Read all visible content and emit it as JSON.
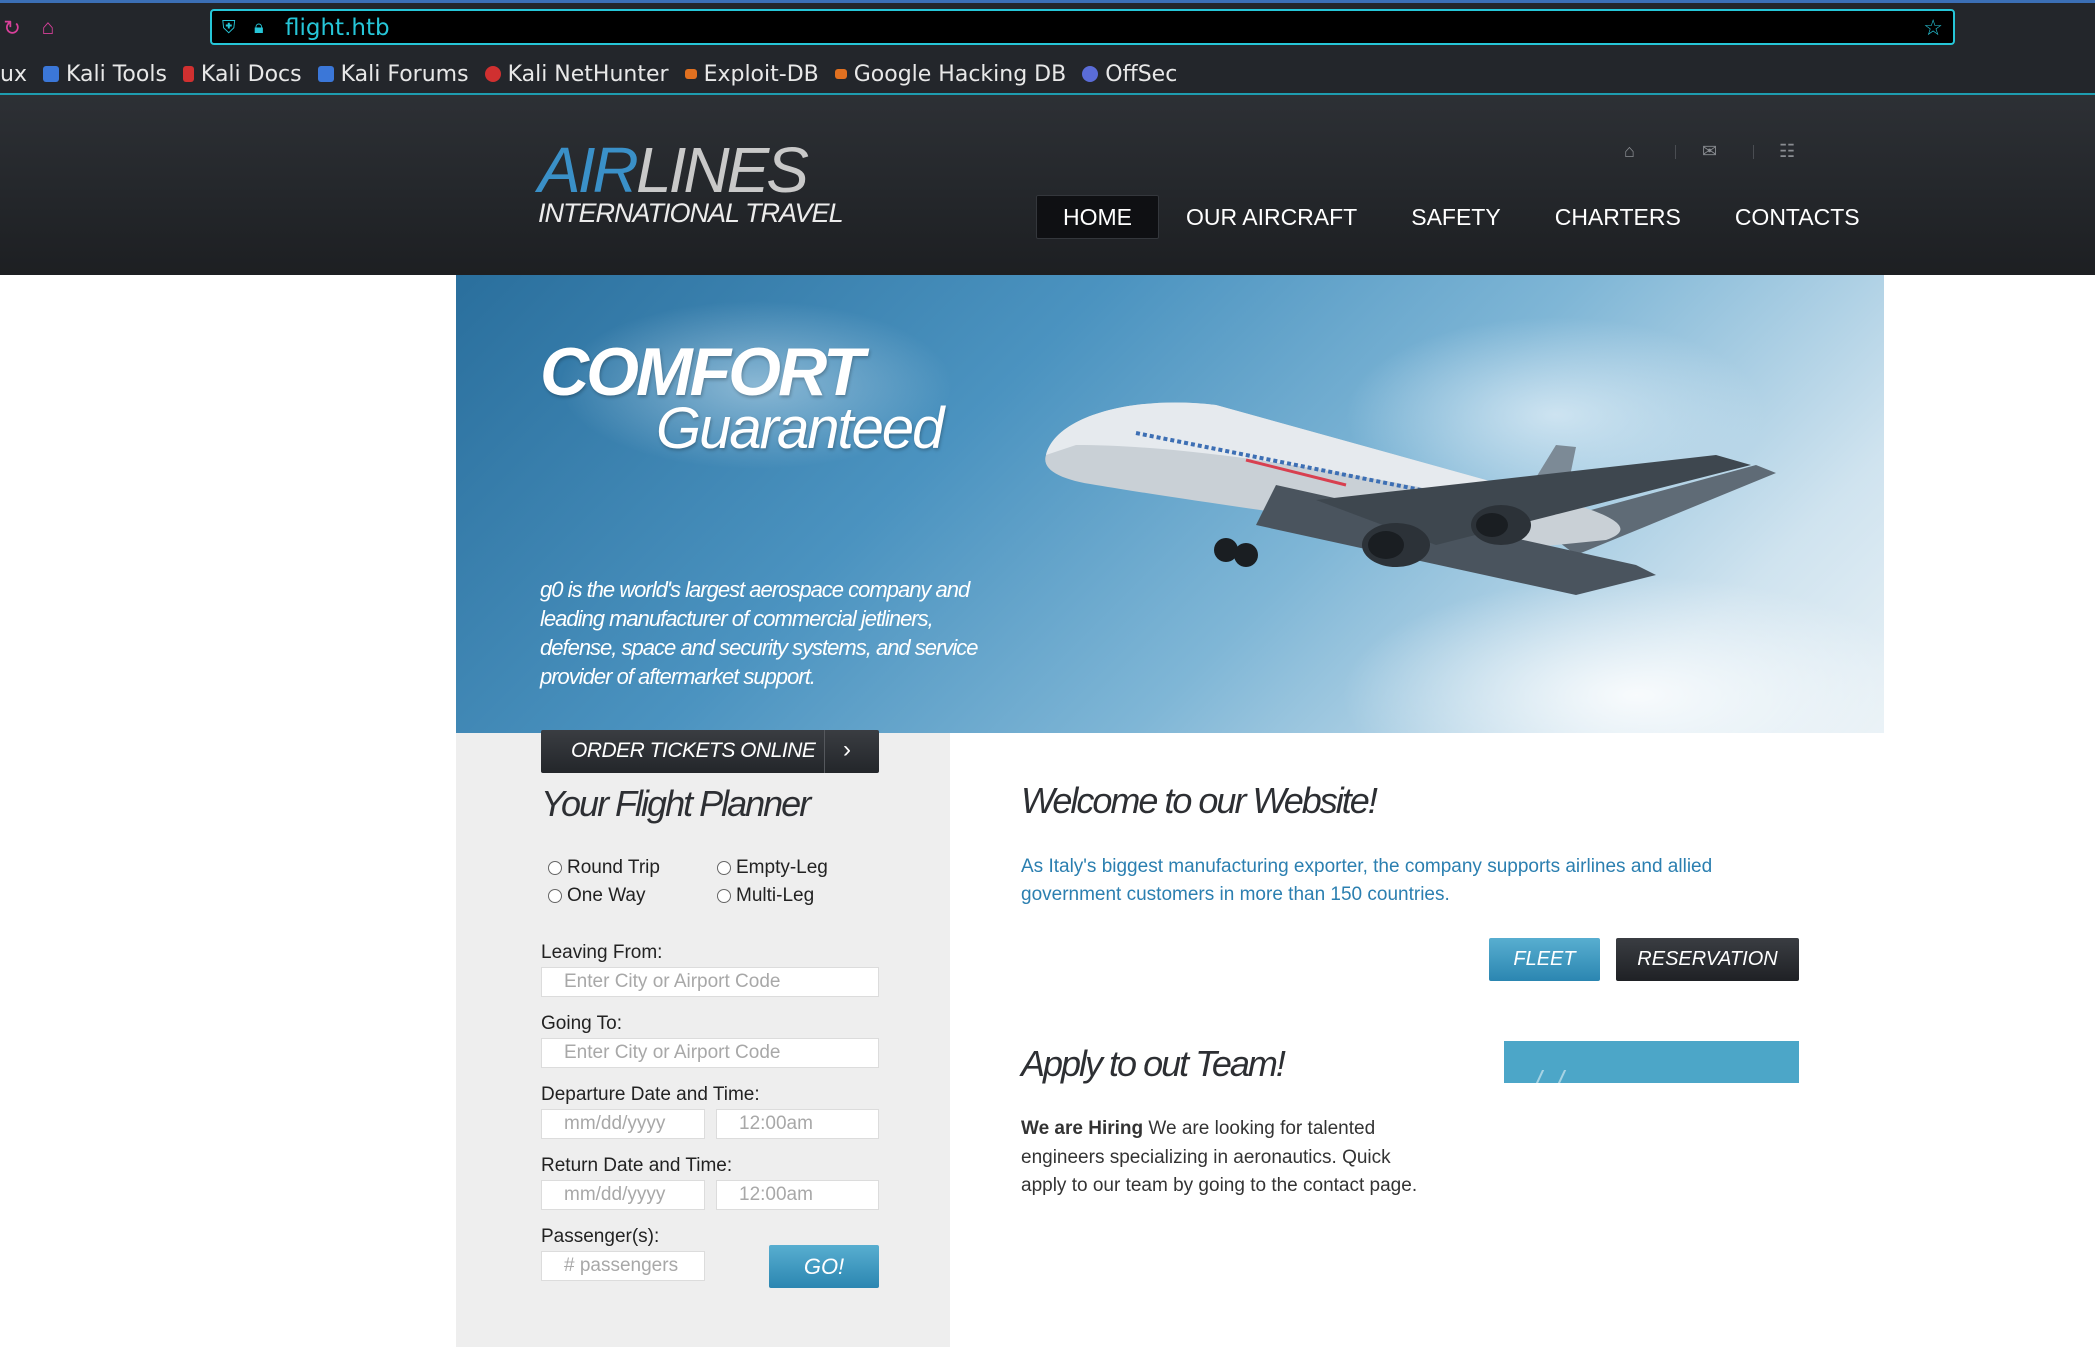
{
  "browser": {
    "url": "flight.htb",
    "bookmarks": [
      {
        "label": "ux",
        "icon": "",
        "color": ""
      },
      {
        "label": "Kali Tools",
        "icon": "kali-tools-icon",
        "color": "#3b77d8"
      },
      {
        "label": "Kali Docs",
        "icon": "kali-docs-icon",
        "color": "#d03030"
      },
      {
        "label": "Kali Forums",
        "icon": "kali-forums-icon",
        "color": "#3b77d8"
      },
      {
        "label": "Kali NetHunter",
        "icon": "kali-nethunter-icon",
        "color": "#d03030"
      },
      {
        "label": "Exploit-DB",
        "icon": "exploit-db-icon",
        "color": "#e07020"
      },
      {
        "label": "Google Hacking DB",
        "icon": "ghdb-icon",
        "color": "#e07020"
      },
      {
        "label": "OffSec",
        "icon": "offsec-icon",
        "color": "#5a6cd8"
      }
    ]
  },
  "header": {
    "logo_air": "AIR",
    "logo_lines": "LINES",
    "logo_sub": "INTERNATIONAL TRAVEL",
    "nav": [
      {
        "label": "HOME",
        "active": true
      },
      {
        "label": "OUR AIRCRAFT",
        "active": false
      },
      {
        "label": "SAFETY",
        "active": false
      },
      {
        "label": "CHARTERS",
        "active": false
      },
      {
        "label": "CONTACTS",
        "active": false
      }
    ]
  },
  "hero": {
    "title_1": "COMFORT",
    "title_2": "Guaranteed",
    "text": "g0 is the world's largest aerospace company and leading manufacturer of commercial jetliners, defense, space and security systems, and service provider of aftermarket support."
  },
  "planner": {
    "order_label": "ORDER TICKETS ONLINE",
    "title": "Your Flight Planner",
    "trip_types": [
      "Round Trip",
      "Empty-Leg",
      "One Way",
      "Multi-Leg"
    ],
    "leaving_label": "Leaving From:",
    "leaving_placeholder": "Enter City or Airport Code",
    "going_label": "Going To:",
    "going_placeholder": "Enter City or Airport Code",
    "departure_label": "Departure Date and Time:",
    "departure_date_placeholder": "mm/dd/yyyy",
    "departure_time_placeholder": "12:00am",
    "return_label": "Return Date and Time:",
    "return_date_placeholder": "mm/dd/yyyy",
    "return_time_placeholder": "12:00am",
    "passengers_label": "Passenger(s):",
    "passengers_placeholder": "# passengers",
    "go_label": "GO!"
  },
  "main": {
    "welcome_title": "Welcome to our Website!",
    "welcome_text": "As Italy's biggest manufacturing exporter, the company supports airlines and allied government customers in more than 150 countries.",
    "fleet_label": "FLEET",
    "reservation_label": "RESERVATION",
    "apply_title": "Apply to out Team!",
    "apply_bold": "We are Hiring",
    "apply_text": " We are looking for talented engineers specializing in aeronautics. Quick apply to our team by going to the contact page."
  },
  "colors": {
    "accent_blue": "#2b86b1",
    "link_blue": "#2b7fb0",
    "header_dark": "#24272b",
    "url_cyan": "#26c6d8"
  }
}
